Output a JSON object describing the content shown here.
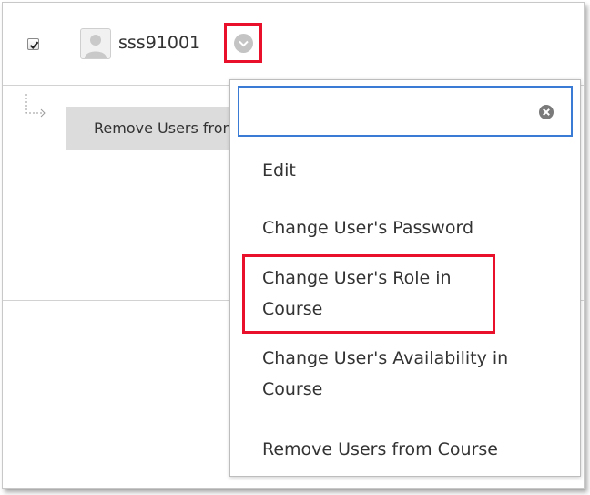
{
  "user_row": {
    "username": "sss91001",
    "checkbox_checked": true
  },
  "actions": {
    "remove_button_label": "Remove Users from Course"
  },
  "menu": {
    "search_value": "",
    "items": [
      {
        "label_line1": "Edit",
        "label_line2": ""
      },
      {
        "label_line1": "Change User's Password",
        "label_line2": ""
      },
      {
        "label_line1": "Change User's Role in",
        "label_line2": "Course"
      },
      {
        "label_line1": "Change User's Availability in",
        "label_line2": "Course"
      },
      {
        "label_line1": "Remove Users from Course",
        "label_line2": ""
      }
    ]
  },
  "colors": {
    "highlight": "#e8102a",
    "search_border": "#3a7bd5",
    "button_bg": "#dcdcdc",
    "text": "#333333"
  },
  "icons": {
    "checkbox": "checkmark-icon",
    "avatar": "user-avatar-icon",
    "menu_trigger": "chevron-down-icon",
    "clear": "clear-circle-x-icon",
    "tree": "tree-connector-icon"
  }
}
